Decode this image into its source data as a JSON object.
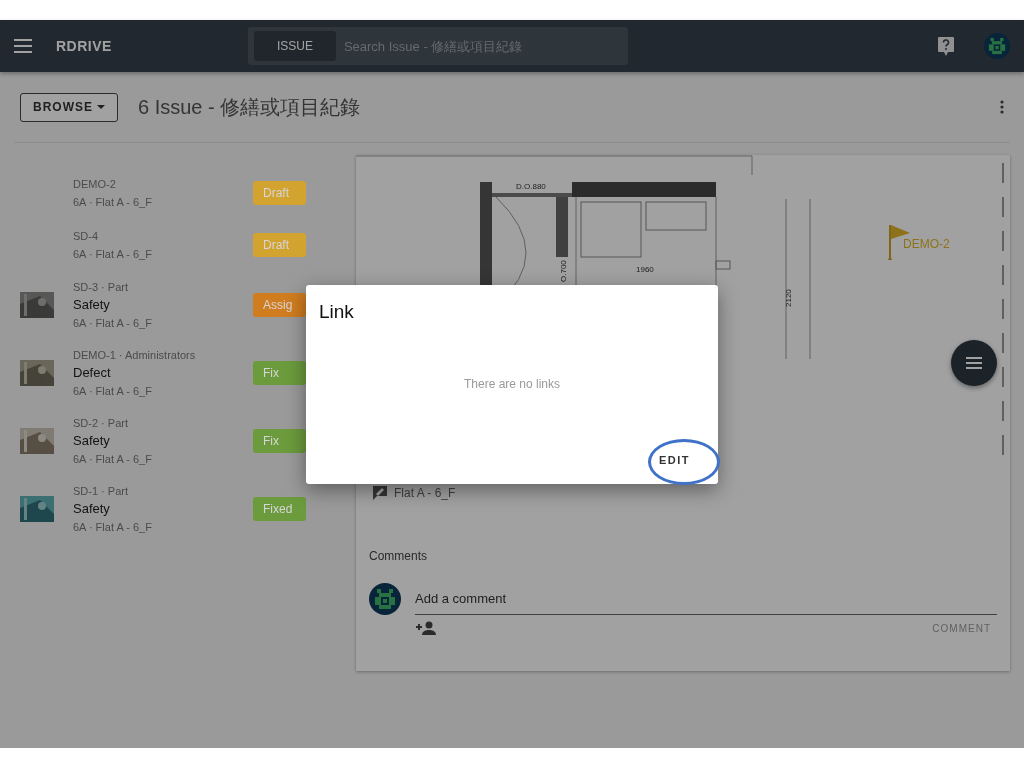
{
  "app_bar": {
    "logo": "RDRIVE",
    "search": {
      "scope": "ISSUE",
      "placeholder": "Search Issue - 修繕或項目紀錄"
    }
  },
  "page": {
    "browse_button": "BROWSE",
    "title": "6 Issue - 修繕或項目紀錄"
  },
  "issues": [
    {
      "ref": "DEMO-2",
      "location": "6A · Flat A - 6_F",
      "status": "Draft",
      "color": "#d2a32e"
    },
    {
      "ref": "SD-4",
      "location": "6A · Flat A - 6_F",
      "status": "Draft",
      "color": "#d2a32e"
    },
    {
      "ref": "SD-3 · Part",
      "category": "Safety",
      "location": "6A · Flat A - 6_F",
      "status": "Assig",
      "color": "#d07d20"
    },
    {
      "ref": "DEMO-1 · Administrators",
      "category": "Defect",
      "location": "6A · Flat A - 6_F",
      "status": "Fix",
      "color": "#6c9b3d"
    },
    {
      "ref": "SD-2 · Part",
      "category": "Safety",
      "location": "6A · Flat A - 6_F",
      "status": "Fix",
      "color": "#6c9b3d"
    },
    {
      "ref": "SD-1 · Part",
      "category": "Safety",
      "location": "6A · Flat A - 6_F",
      "status": "Fixed",
      "color": "#6c9b3d"
    }
  ],
  "detail": {
    "plan": {
      "labels": [
        "D.O.880",
        "O.700",
        "1960",
        "2120"
      ],
      "pin": "DEMO-2"
    },
    "location": "Flat A - 6_F",
    "comments_heading": "Comments",
    "comment_field": {
      "placeholder": "Add a comment"
    },
    "comment_button": "COMMENT"
  },
  "dialog": {
    "title": "Link",
    "empty_text": "There are no links",
    "edit_button": "EDIT"
  }
}
